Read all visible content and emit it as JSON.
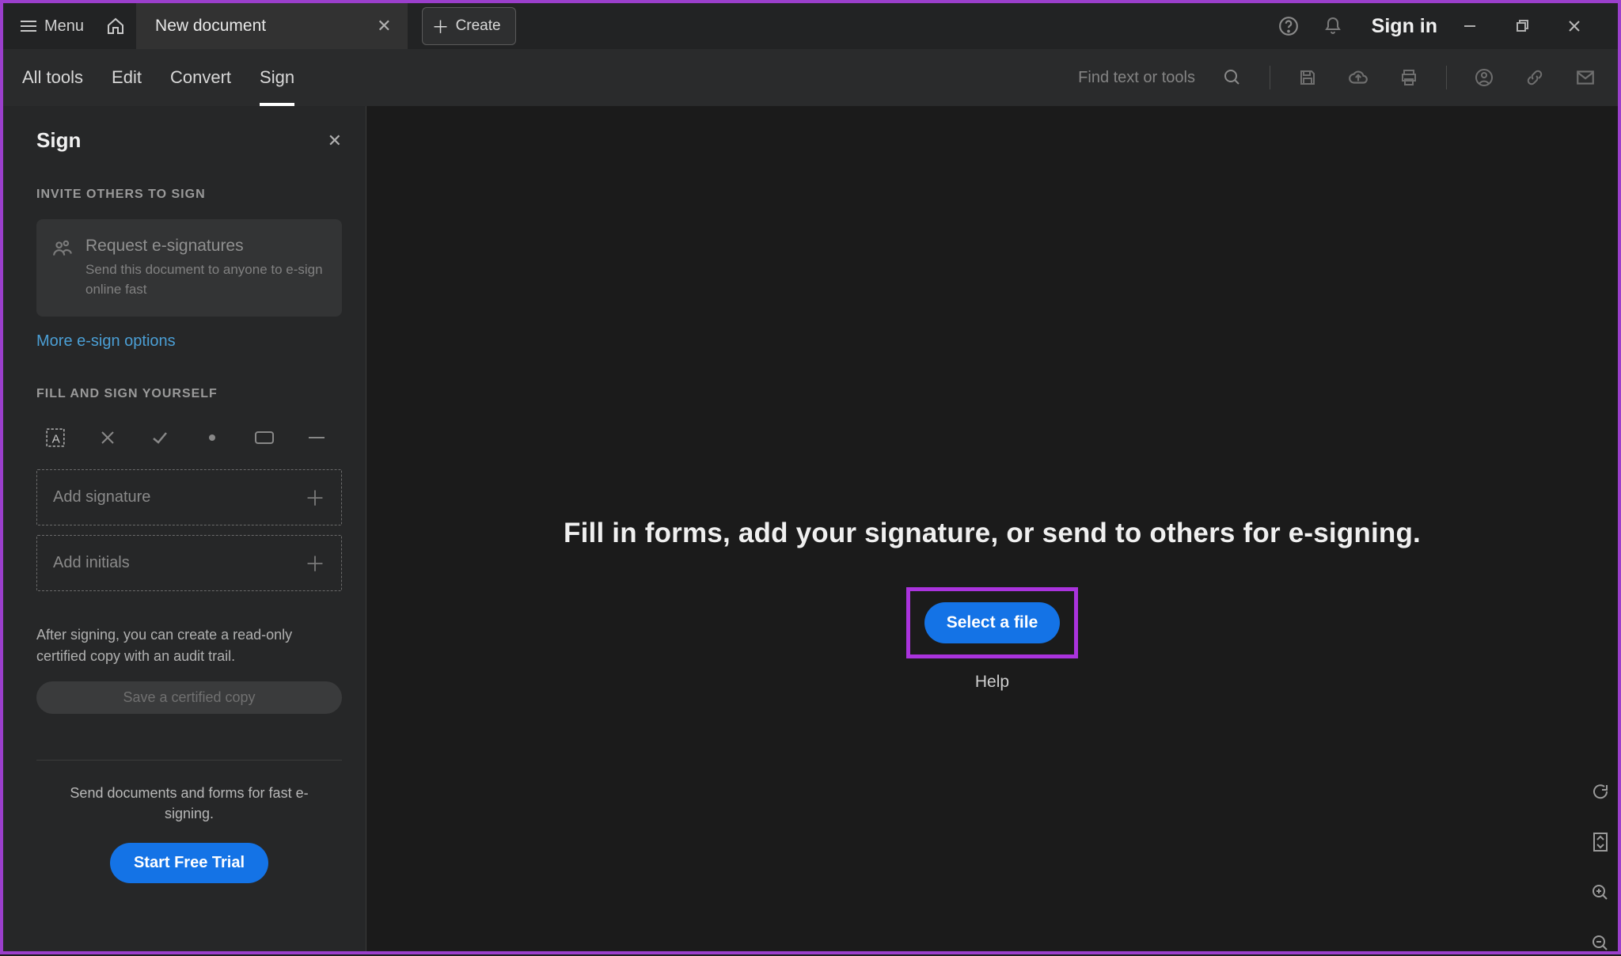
{
  "title_bar": {
    "menu_label": "Menu",
    "tab_title": "New document",
    "create_label": "Create",
    "sign_in_label": "Sign in"
  },
  "sub_nav": {
    "tabs": [
      "All tools",
      "Edit",
      "Convert",
      "Sign"
    ],
    "active_index": 3,
    "find_placeholder": "Find text or tools"
  },
  "sidebar": {
    "title": "Sign",
    "invite_label": "INVITE OTHERS TO SIGN",
    "card_title": "Request e-signatures",
    "card_desc": "Send this document to anyone to e-sign online fast",
    "more_link": "More e-sign options",
    "self_label": "FILL AND SIGN YOURSELF",
    "add_signature": "Add signature",
    "add_initials": "Add initials",
    "info": "After signing, you can create a read-only certified copy with an audit trail.",
    "save_copy_label": "Save a certified copy",
    "promo_text": "Send documents and forms for fast e-signing.",
    "trial_label": "Start Free Trial"
  },
  "main": {
    "headline": "Fill in forms, add your signature, or send to others for e-signing.",
    "select_file_label": "Select a file",
    "help_label": "Help"
  },
  "colors": {
    "accent": "#1473e6",
    "highlight": "#aa33dd",
    "link": "#4b9fd5"
  }
}
